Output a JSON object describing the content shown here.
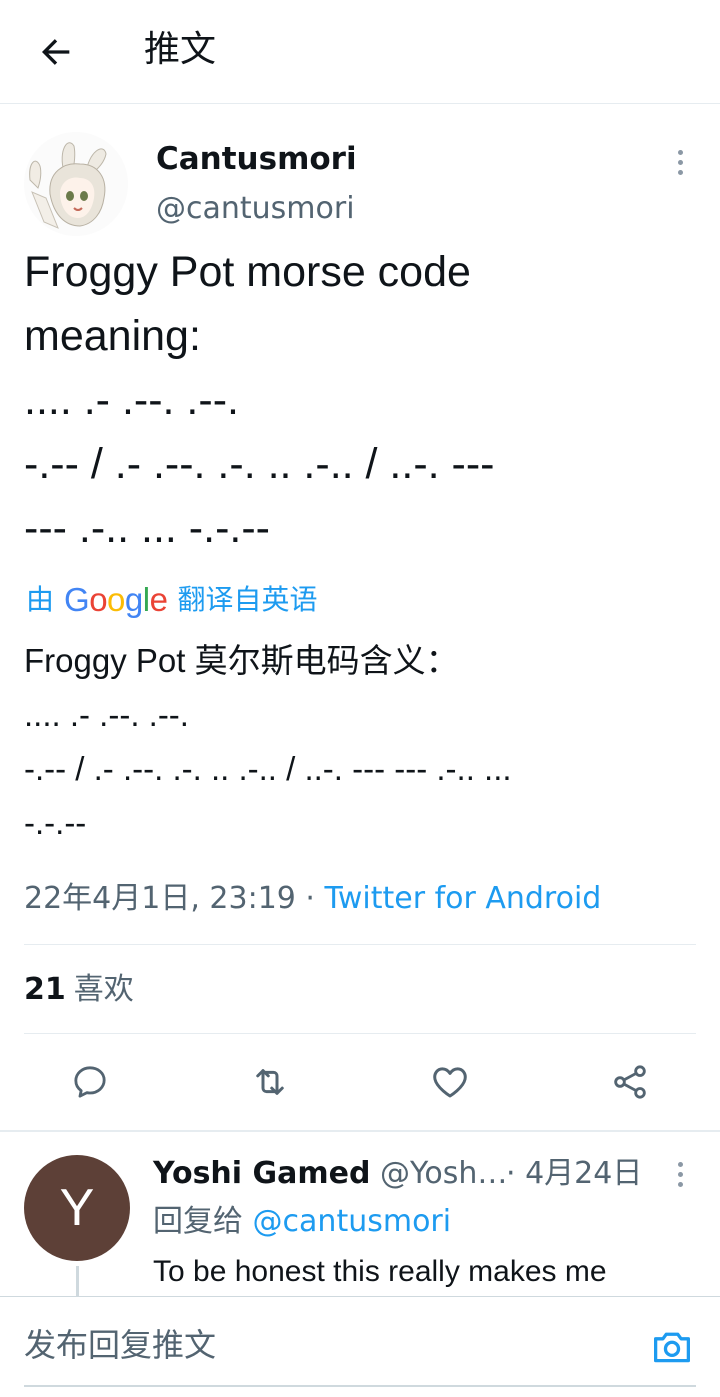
{
  "header": {
    "title": "推文"
  },
  "tweet": {
    "author_name": "Cantusmori",
    "author_handle": "@cantusmori",
    "text": "Froggy Pot morse code\nmeaning:\n.... .- .--. .--.\n-.-- / .- .--. .-. .. .-.. / ..-. ---\n--- .-.. ... -.-.--",
    "translate_prefix": "由",
    "translate_brand": "Google",
    "translate_suffix": "翻译自英语",
    "translated_text": "Froggy Pot 莫尔斯电码含义：\n .... .- .--. .--.\n-.-- / .- .--. .-. .. .-.. / ..-. --- --- .-.. ...\n-.-.--",
    "timestamp": "22年4月1日, 23:19",
    "separator": " · ",
    "source": "Twitter for Android",
    "likes_count": "21",
    "likes_label": "喜欢"
  },
  "reply": {
    "avatar_letter": "Y",
    "name": "Yoshi Gamed",
    "handle": "@Yosh…",
    "date": "· 4月24日",
    "reply_to_label": "回复给",
    "reply_to_handle": "@cantusmori",
    "text": "To be honest this really makes me"
  },
  "compose": {
    "placeholder": "发布回复推文"
  },
  "colors": {
    "accent": "#1d9bf0",
    "secondary_text": "#536471",
    "avatar_bg": "#5d4037"
  }
}
